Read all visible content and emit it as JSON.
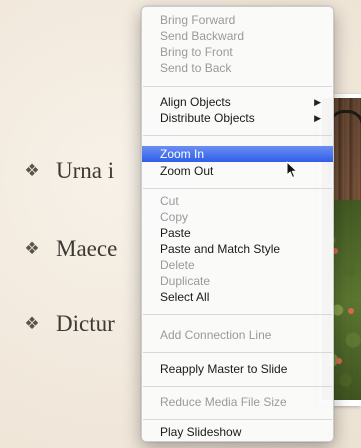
{
  "slide": {
    "bullets": [
      {
        "glyph": "❖",
        "text": "Urna i"
      },
      {
        "glyph": "❖",
        "text": "Maece"
      },
      {
        "glyph": "❖",
        "text": "Dictur"
      }
    ]
  },
  "menu": {
    "arrange": {
      "bring_forward": "Bring Forward",
      "send_backward": "Send Backward",
      "bring_to_front": "Bring to Front",
      "send_to_back": "Send to Back"
    },
    "align_objects": "Align Objects",
    "distribute_objects": "Distribute Objects",
    "submenu_arrow": "▶",
    "zoom_in": "Zoom In",
    "zoom_out": "Zoom Out",
    "cut": "Cut",
    "copy": "Copy",
    "paste": "Paste",
    "paste_and_match_style": "Paste and Match Style",
    "delete": "Delete",
    "duplicate": "Duplicate",
    "select_all": "Select All",
    "add_connection_line": "Add Connection Line",
    "reapply_master": "Reapply Master to Slide",
    "reduce_media": "Reduce Media File Size",
    "play_slideshow": "Play Slideshow",
    "highlighted_item": "Zoom In"
  },
  "colors": {
    "highlight": "#2f5fe8",
    "disabled_text": "#9a9a9a",
    "slide_background": "#f4ede3"
  },
  "icons": {
    "cursor": "arrow-cursor-icon",
    "bullet": "diamond-bullet-icon"
  }
}
